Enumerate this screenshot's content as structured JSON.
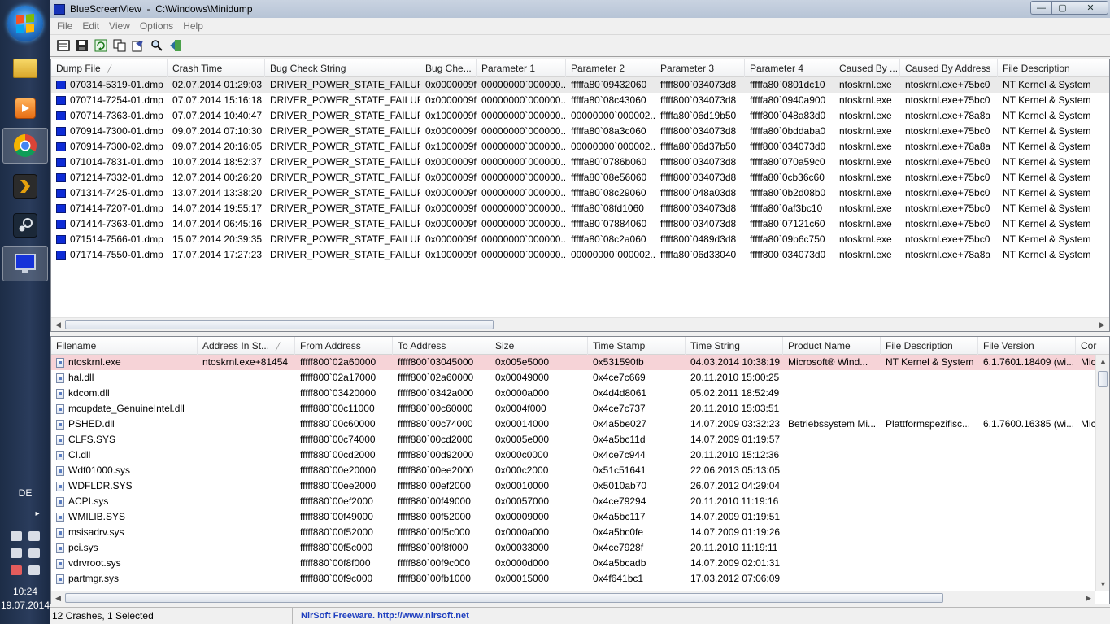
{
  "window": {
    "app_name": "BlueScreenView",
    "path": "C:\\Windows\\Minidump",
    "controls": {
      "minimize": "—",
      "maximize": "▢",
      "close": "✕"
    }
  },
  "menu": [
    "File",
    "Edit",
    "View",
    "Options",
    "Help"
  ],
  "toolbar": [
    "properties-icon",
    "save-icon",
    "refresh-icon",
    "copy-icon",
    "html-report-icon",
    "find-icon",
    "exit-icon"
  ],
  "crashes": {
    "columns": [
      "Dump File",
      "Crash Time",
      "Bug Check String",
      "Bug Che...",
      "Parameter 1",
      "Parameter 2",
      "Parameter 3",
      "Parameter 4",
      "Caused By ...",
      "Caused By Address",
      "File Description"
    ],
    "sort_column": "Dump File",
    "selected_index": 0,
    "rows": [
      [
        "070314-5319-01.dmp",
        "02.07.2014 01:29:03",
        "DRIVER_POWER_STATE_FAILURE",
        "0x0000009f",
        "00000000`000000...",
        "fffffa80`09432060",
        "fffff800`034073d8",
        "fffffa80`0801dc10",
        "ntoskrnl.exe",
        "ntoskrnl.exe+75bc0",
        "NT Kernel & System"
      ],
      [
        "070714-7254-01.dmp",
        "07.07.2014 15:16:18",
        "DRIVER_POWER_STATE_FAILURE",
        "0x0000009f",
        "00000000`000000...",
        "fffffa80`08c43060",
        "fffff800`034073d8",
        "fffffa80`0940a900",
        "ntoskrnl.exe",
        "ntoskrnl.exe+75bc0",
        "NT Kernel & System"
      ],
      [
        "070714-7363-01.dmp",
        "07.07.2014 10:40:47",
        "DRIVER_POWER_STATE_FAILURE",
        "0x1000009f",
        "00000000`000000...",
        "00000000`000002...",
        "fffffa80`06d19b50",
        "fffff800`048a83d0",
        "ntoskrnl.exe",
        "ntoskrnl.exe+78a8a",
        "NT Kernel & System"
      ],
      [
        "070914-7300-01.dmp",
        "09.07.2014 07:10:30",
        "DRIVER_POWER_STATE_FAILURE",
        "0x0000009f",
        "00000000`000000...",
        "fffffa80`08a3c060",
        "fffff800`034073d8",
        "fffffa80`0bddaba0",
        "ntoskrnl.exe",
        "ntoskrnl.exe+75bc0",
        "NT Kernel & System"
      ],
      [
        "070914-7300-02.dmp",
        "09.07.2014 20:16:05",
        "DRIVER_POWER_STATE_FAILURE",
        "0x1000009f",
        "00000000`000000...",
        "00000000`000002...",
        "fffffa80`06d37b50",
        "fffff800`034073d0",
        "ntoskrnl.exe",
        "ntoskrnl.exe+78a8a",
        "NT Kernel & System"
      ],
      [
        "071014-7831-01.dmp",
        "10.07.2014 18:52:37",
        "DRIVER_POWER_STATE_FAILURE",
        "0x0000009f",
        "00000000`000000...",
        "fffffa80`0786b060",
        "fffff800`034073d8",
        "fffffa80`070a59c0",
        "ntoskrnl.exe",
        "ntoskrnl.exe+75bc0",
        "NT Kernel & System"
      ],
      [
        "071214-7332-01.dmp",
        "12.07.2014 00:26:20",
        "DRIVER_POWER_STATE_FAILURE",
        "0x0000009f",
        "00000000`000000...",
        "fffffa80`08e56060",
        "fffff800`034073d8",
        "fffffa80`0cb36c60",
        "ntoskrnl.exe",
        "ntoskrnl.exe+75bc0",
        "NT Kernel & System"
      ],
      [
        "071314-7425-01.dmp",
        "13.07.2014 13:38:20",
        "DRIVER_POWER_STATE_FAILURE",
        "0x0000009f",
        "00000000`000000...",
        "fffffa80`08c29060",
        "fffff800`048a03d8",
        "fffffa80`0b2d08b0",
        "ntoskrnl.exe",
        "ntoskrnl.exe+75bc0",
        "NT Kernel & System"
      ],
      [
        "071414-7207-01.dmp",
        "14.07.2014 19:55:17",
        "DRIVER_POWER_STATE_FAILURE",
        "0x0000009f",
        "00000000`000000...",
        "fffffa80`08fd1060",
        "fffff800`034073d8",
        "fffffa80`0af3bc10",
        "ntoskrnl.exe",
        "ntoskrnl.exe+75bc0",
        "NT Kernel & System"
      ],
      [
        "071414-7363-01.dmp",
        "14.07.2014 06:45:16",
        "DRIVER_POWER_STATE_FAILURE",
        "0x0000009f",
        "00000000`000000...",
        "fffffa80`07884060",
        "fffff800`034073d8",
        "fffffa80`07121c60",
        "ntoskrnl.exe",
        "ntoskrnl.exe+75bc0",
        "NT Kernel & System"
      ],
      [
        "071514-7566-01.dmp",
        "15.07.2014 20:39:35",
        "DRIVER_POWER_STATE_FAILURE",
        "0x0000009f",
        "00000000`000000...",
        "fffffa80`08c2a060",
        "fffff800`0489d3d8",
        "fffffa80`09b6c750",
        "ntoskrnl.exe",
        "ntoskrnl.exe+75bc0",
        "NT Kernel & System"
      ],
      [
        "071714-7550-01.dmp",
        "17.07.2014 17:27:23",
        "DRIVER_POWER_STATE_FAILURE",
        "0x1000009f",
        "00000000`000000...",
        "00000000`000002...",
        "fffffa80`06d33040",
        "fffff800`034073d0",
        "ntoskrnl.exe",
        "ntoskrnl.exe+78a8a",
        "NT Kernel & System"
      ]
    ]
  },
  "drivers": {
    "columns": [
      "Filename",
      "Address In St...",
      "From Address",
      "To Address",
      "Size",
      "Time Stamp",
      "Time String",
      "Product Name",
      "File Description",
      "File Version",
      "Cor"
    ],
    "sort_column": "Address In St...",
    "highlighted_index": 0,
    "rows": [
      [
        "ntoskrnl.exe",
        "ntoskrnl.exe+81454",
        "fffff800`02a60000",
        "fffff800`03045000",
        "0x005e5000",
        "0x531590fb",
        "04.03.2014 10:38:19",
        "Microsoft® Wind...",
        "NT Kernel & System",
        "6.1.7601.18409 (wi...",
        "Mic"
      ],
      [
        "hal.dll",
        "",
        "fffff800`02a17000",
        "fffff800`02a60000",
        "0x00049000",
        "0x4ce7c669",
        "20.11.2010 15:00:25",
        "",
        "",
        "",
        ""
      ],
      [
        "kdcom.dll",
        "",
        "fffff800`03420000",
        "fffff800`0342a000",
        "0x0000a000",
        "0x4d4d8061",
        "05.02.2011 18:52:49",
        "",
        "",
        "",
        ""
      ],
      [
        "mcupdate_GenuineIntel.dll",
        "",
        "fffff880`00c11000",
        "fffff880`00c60000",
        "0x0004f000",
        "0x4ce7c737",
        "20.11.2010 15:03:51",
        "",
        "",
        "",
        ""
      ],
      [
        "PSHED.dll",
        "",
        "fffff880`00c60000",
        "fffff880`00c74000",
        "0x00014000",
        "0x4a5be027",
        "14.07.2009 03:32:23",
        "Betriebssystem Mi...",
        "Plattformspezifisc...",
        "6.1.7600.16385 (wi...",
        "Mic"
      ],
      [
        "CLFS.SYS",
        "",
        "fffff880`00c74000",
        "fffff880`00cd2000",
        "0x0005e000",
        "0x4a5bc11d",
        "14.07.2009 01:19:57",
        "",
        "",
        "",
        ""
      ],
      [
        "CI.dll",
        "",
        "fffff880`00cd2000",
        "fffff880`00d92000",
        "0x000c0000",
        "0x4ce7c944",
        "20.11.2010 15:12:36",
        "",
        "",
        "",
        ""
      ],
      [
        "Wdf01000.sys",
        "",
        "fffff880`00e20000",
        "fffff880`00ee2000",
        "0x000c2000",
        "0x51c51641",
        "22.06.2013 05:13:05",
        "",
        "",
        "",
        ""
      ],
      [
        "WDFLDR.SYS",
        "",
        "fffff880`00ee2000",
        "fffff880`00ef2000",
        "0x00010000",
        "0x5010ab70",
        "26.07.2012 04:29:04",
        "",
        "",
        "",
        ""
      ],
      [
        "ACPI.sys",
        "",
        "fffff880`00ef2000",
        "fffff880`00f49000",
        "0x00057000",
        "0x4ce79294",
        "20.11.2010 11:19:16",
        "",
        "",
        "",
        ""
      ],
      [
        "WMILIB.SYS",
        "",
        "fffff880`00f49000",
        "fffff880`00f52000",
        "0x00009000",
        "0x4a5bc117",
        "14.07.2009 01:19:51",
        "",
        "",
        "",
        ""
      ],
      [
        "msisadrv.sys",
        "",
        "fffff880`00f52000",
        "fffff880`00f5c000",
        "0x0000a000",
        "0x4a5bc0fe",
        "14.07.2009 01:19:26",
        "",
        "",
        "",
        ""
      ],
      [
        "pci.sys",
        "",
        "fffff880`00f5c000",
        "fffff880`00f8f000",
        "0x00033000",
        "0x4ce7928f",
        "20.11.2010 11:19:11",
        "",
        "",
        "",
        ""
      ],
      [
        "vdrvroot.sys",
        "",
        "fffff880`00f8f000",
        "fffff880`00f9c000",
        "0x0000d000",
        "0x4a5bcadb",
        "14.07.2009 02:01:31",
        "",
        "",
        "",
        ""
      ],
      [
        "partmgr.sys",
        "",
        "fffff880`00f9c000",
        "fffff880`00fb1000",
        "0x00015000",
        "0x4f641bc1",
        "17.03.2012 07:06:09",
        "",
        "",
        "",
        ""
      ]
    ]
  },
  "statusbar": {
    "count": "12 Crashes, 1 Selected",
    "link": "NirSoft Freeware.  http://www.nirsoft.net"
  },
  "taskbar": {
    "apps": [
      "explorer-icon",
      "media-player-icon",
      "chrome-icon",
      "plex-icon",
      "steam-icon",
      "bluescreenview-icon"
    ],
    "active_app": "chrome-icon",
    "language": "DE",
    "time": "10:24",
    "date": "19.07.2014"
  },
  "colors": {
    "selected_row": "#eaeaea",
    "highlighted_row": "#f6d3d7",
    "link": "#1f3fbf",
    "dump_icon": "#0d2bd6"
  }
}
